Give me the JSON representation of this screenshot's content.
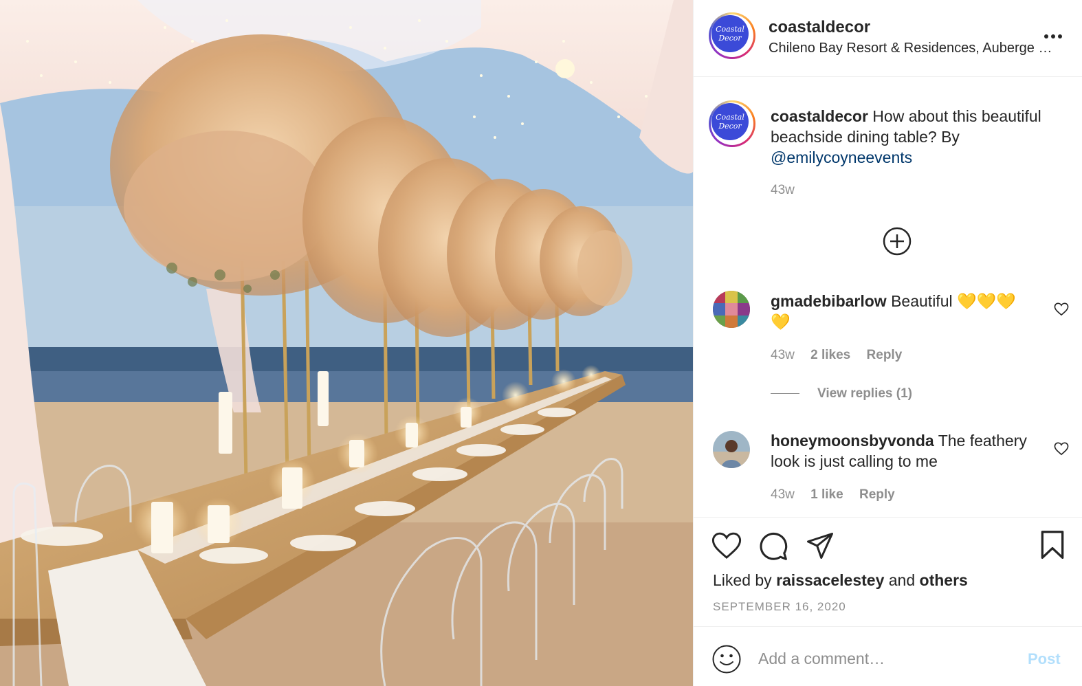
{
  "post": {
    "image_alt": "Beachside dining table with pampas grass centerpieces and candles under a draped tent with string lights",
    "header": {
      "username": "coastaldecor",
      "location": "Chileno Bay Resort & Residences, Auberge Resorts Collection",
      "avatar_text": "Coastal Decor"
    },
    "caption": {
      "username": "coastaldecor",
      "text": "How about this beautiful beachside dining table? By",
      "mention": "@emilycoyneevents",
      "time": "43w"
    },
    "comments": [
      {
        "username": "gmadebibarlow",
        "text": "Beautiful 💛💛💛💛",
        "time": "43w",
        "likes": "2 likes",
        "reply": "Reply",
        "view_replies": "View replies (1)"
      },
      {
        "username": "honeymoonsbyvonda",
        "text": "The feathery look is just calling to me",
        "time": "43w",
        "likes": "1 like",
        "reply": "Reply"
      }
    ],
    "liked_by": {
      "prefix": "Liked by",
      "user": "raissacelestey",
      "and": "and",
      "others": "others"
    },
    "date": "SEPTEMBER 16, 2020",
    "comment_box": {
      "placeholder": "Add a comment…",
      "post_label": "Post"
    },
    "icons": {
      "more": "more-options-icon",
      "load_more": "plus-circle-icon",
      "like": "heart-icon",
      "comment": "comment-bubble-icon",
      "share": "paper-plane-icon",
      "save": "bookmark-icon",
      "emoji": "smiley-icon"
    },
    "colors": {
      "mention": "#00376b",
      "secondary_text": "#8e8e8e",
      "post_disabled": "#b2dffc",
      "avatar_bg": "#3b4ad8"
    }
  }
}
